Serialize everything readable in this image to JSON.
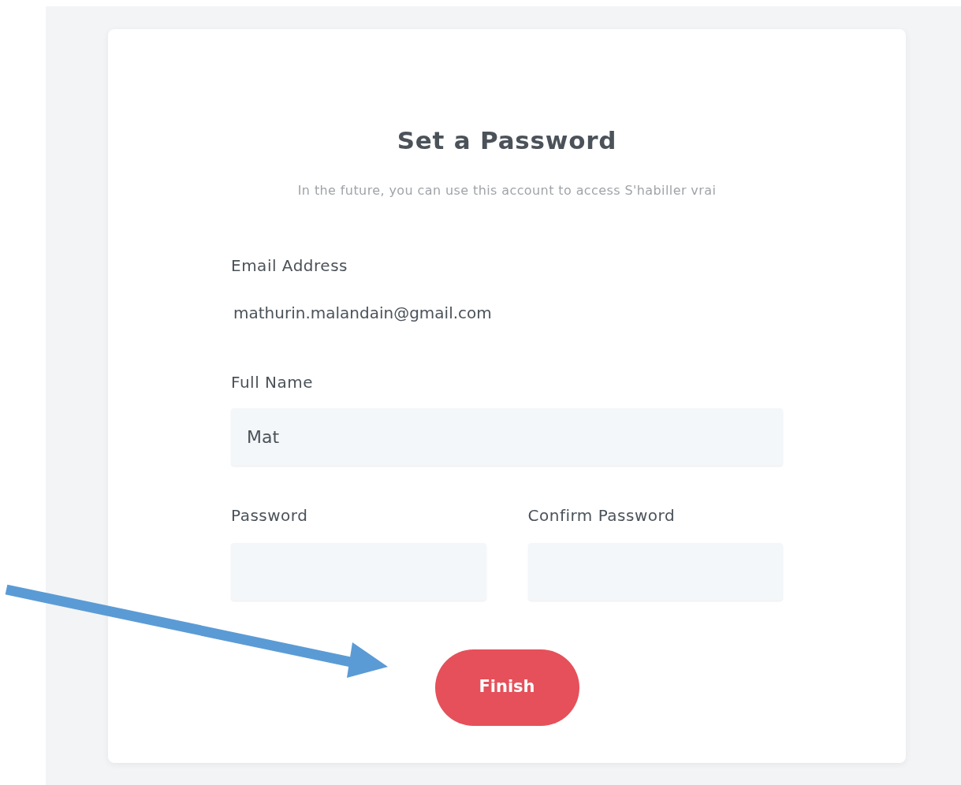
{
  "title": "Set a Password",
  "subtitle": "In the future, you can use this account to access S'habiller vrai",
  "email": {
    "label": "Email Address",
    "value": "mathurin.malandain@gmail.com"
  },
  "full_name": {
    "label": "Full Name",
    "value": "Mat"
  },
  "password": {
    "label": "Password"
  },
  "confirm_password": {
    "label": "Confirm Password"
  },
  "button": "Finish"
}
